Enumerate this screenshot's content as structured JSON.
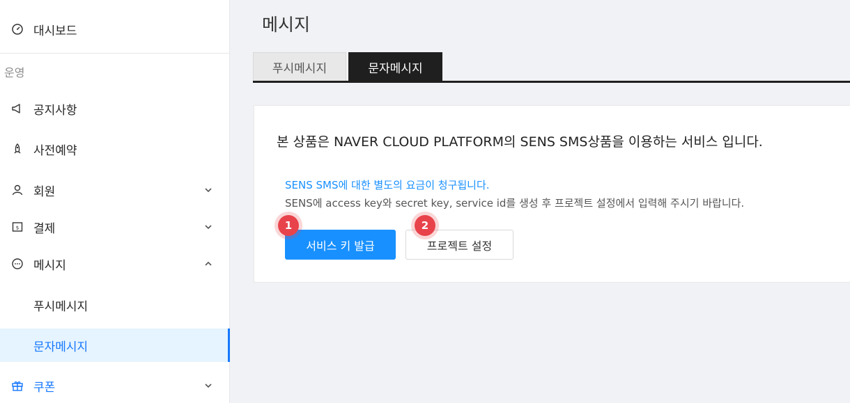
{
  "sidebar": {
    "dashboard": {
      "label": "대시보드",
      "icon": "dashboard-icon"
    },
    "group_title": "운영",
    "items": [
      {
        "label": "공지사항",
        "icon": "megaphone-icon"
      },
      {
        "label": "사전예약",
        "icon": "rocket-icon"
      },
      {
        "label": "회원",
        "icon": "user-icon",
        "expandable": true
      },
      {
        "label": "결제",
        "icon": "receipt-icon",
        "expandable": true
      },
      {
        "label": "메시지",
        "icon": "message-icon",
        "expanded": true
      },
      {
        "label": "쿠폰",
        "icon": "gift-icon",
        "expandable": true
      }
    ],
    "sub_items": [
      {
        "label": "푸시메시지"
      },
      {
        "label": "문자메시지",
        "active": true
      }
    ]
  },
  "main": {
    "title": "메시지",
    "tabs": [
      {
        "label": "푸시메시지",
        "active": false
      },
      {
        "label": "문자메시지",
        "active": true
      }
    ],
    "card": {
      "intro": "본 상품은 NAVER CLOUD PLATFORM의 SENS SMS상품을 이용하는 서비스 입니다.",
      "notice": "SENS SMS에 대한 별도의 요금이 청구됩니다.",
      "description": "SENS에 access key와 secret key, service id를 생성 후 프로젝트 설정에서 입력해 주시기 바랍니다.",
      "primary_button": "서비스 키 발급",
      "secondary_button": "프로젝트 설정",
      "badges": [
        "1",
        "2"
      ]
    }
  },
  "colors": {
    "accent": "#1890ff",
    "active_tab": "#1f1f1f",
    "badge": "#e8434b"
  }
}
